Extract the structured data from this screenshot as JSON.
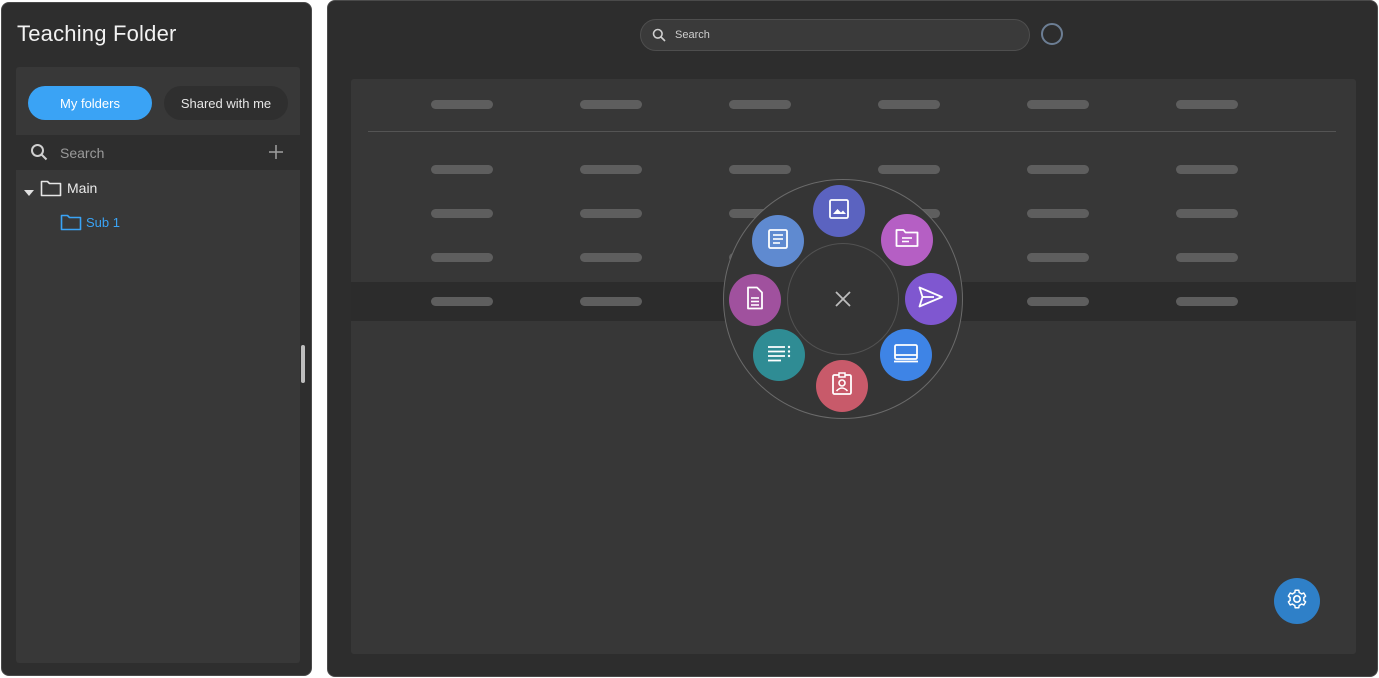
{
  "sidebar": {
    "title": "Teaching Folder",
    "tabs": [
      {
        "label": "My folders",
        "active": true
      },
      {
        "label": "Shared with me",
        "active": false
      }
    ],
    "search": {
      "placeholder": "Search"
    },
    "tree": [
      {
        "label": "Main",
        "expanded": true,
        "children": [
          {
            "label": "Sub 1",
            "selected": true
          }
        ]
      }
    ]
  },
  "header": {
    "search": {
      "placeholder": "Search"
    },
    "status_icon": "loading-spinner-icon"
  },
  "table": {
    "column_count": 6,
    "row_count": 4,
    "highlighted_row": 4,
    "content": "loading-placeholder-bars"
  },
  "radial_menu": {
    "center_icon": "close-icon",
    "items": [
      {
        "icon": "image-icon",
        "color": "#5b63c0"
      },
      {
        "icon": "folder-open-icon",
        "color": "#b55fc4"
      },
      {
        "icon": "send-icon",
        "color": "#7f57d0"
      },
      {
        "icon": "monitor-icon",
        "color": "#3e84e6"
      },
      {
        "icon": "contact-card-icon",
        "color": "#c85a6a"
      },
      {
        "icon": "list-icon",
        "color": "#2f8c94"
      },
      {
        "icon": "document-icon",
        "color": "#a0519e"
      },
      {
        "icon": "notes-icon",
        "color": "#5f8ad0"
      }
    ]
  },
  "fab": {
    "icon": "gear-icon",
    "color": "#2f80c8"
  },
  "colors": {
    "accent": "#3aa3f5",
    "panel_bg": "#2e2e2e",
    "card_bg": "#373737"
  }
}
